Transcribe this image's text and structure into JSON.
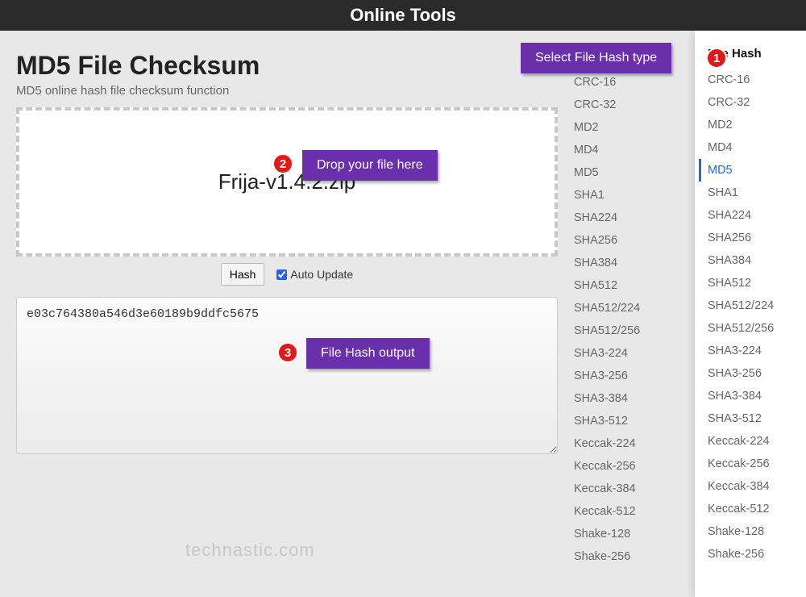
{
  "header": {
    "title": "Online Tools"
  },
  "page": {
    "title": "MD5 File Checksum",
    "subtitle": "MD5 online hash file checksum function"
  },
  "dropzone": {
    "filename": "Frija-v1.4.2.zip"
  },
  "controls": {
    "hash_button": "Hash",
    "auto_update_label": "Auto Update",
    "auto_update_checked": true
  },
  "output": {
    "value": "e03c764380a546d3e60189b9ddfc5675"
  },
  "callouts": {
    "c1": "Select File Hash type",
    "c2": "Drop your file here",
    "c3": "File Hash output",
    "b1": "1",
    "b2": "2",
    "b3": "3"
  },
  "sidebar_left": {
    "items": [
      "CRC-16",
      "CRC-32",
      "MD2",
      "MD4",
      "MD5",
      "SHA1",
      "SHA224",
      "SHA256",
      "SHA384",
      "SHA512",
      "SHA512/224",
      "SHA512/256",
      "SHA3-224",
      "SHA3-256",
      "SHA3-384",
      "SHA3-512",
      "Keccak-224",
      "Keccak-256",
      "Keccak-384",
      "Keccak-512",
      "Shake-128",
      "Shake-256"
    ]
  },
  "sidebar_right": {
    "title": "File Hash",
    "selected": "MD5",
    "items": [
      "CRC-16",
      "CRC-32",
      "MD2",
      "MD4",
      "MD5",
      "SHA1",
      "SHA224",
      "SHA256",
      "SHA384",
      "SHA512",
      "SHA512/224",
      "SHA512/256",
      "SHA3-224",
      "SHA3-256",
      "SHA3-384",
      "SHA3-512",
      "Keccak-224",
      "Keccak-256",
      "Keccak-384",
      "Keccak-512",
      "Shake-128",
      "Shake-256"
    ]
  },
  "watermark": "technastic.com"
}
